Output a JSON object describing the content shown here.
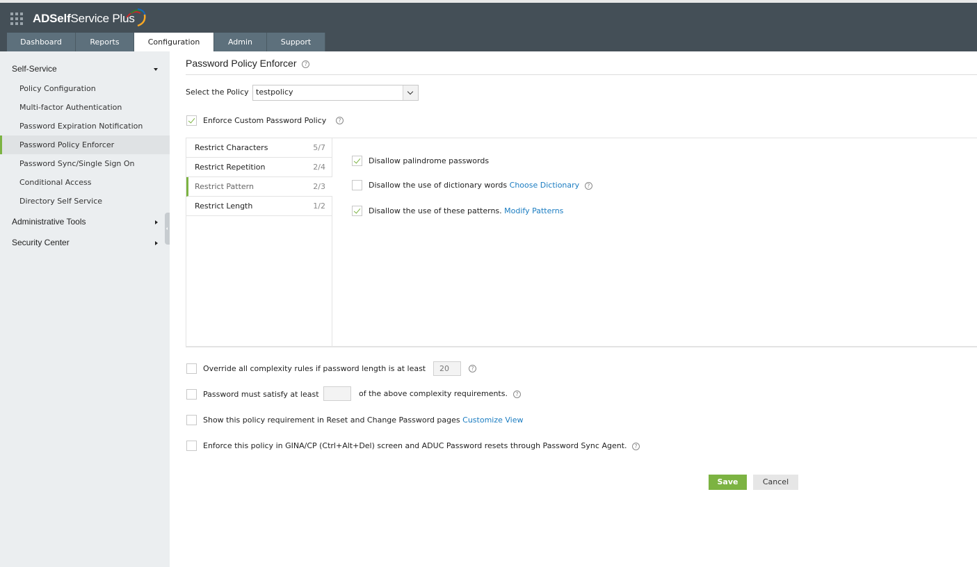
{
  "app": {
    "brand_bold": "ADSelf",
    "brand_rest": "Service Plus"
  },
  "tabs": [
    {
      "label": "Dashboard",
      "active": false
    },
    {
      "label": "Reports",
      "active": false
    },
    {
      "label": "Configuration",
      "active": true
    },
    {
      "label": "Admin",
      "active": false
    },
    {
      "label": "Support",
      "active": false
    }
  ],
  "sidebar": {
    "sections": [
      {
        "label": "Self-Service",
        "expanded": true
      },
      {
        "label": "Administrative Tools",
        "expanded": false
      },
      {
        "label": "Security Center",
        "expanded": false
      }
    ],
    "items": [
      {
        "label": "Policy Configuration"
      },
      {
        "label": "Multi-factor Authentication"
      },
      {
        "label": "Password Expiration Notification"
      },
      {
        "label": "Password Policy Enforcer",
        "active": true
      },
      {
        "label": "Password Sync/Single Sign On"
      },
      {
        "label": "Conditional Access"
      },
      {
        "label": "Directory Self Service"
      }
    ]
  },
  "main": {
    "title": "Password Policy Enforcer",
    "help_glyph": "?",
    "select_policy_label": "Select the Policy",
    "select_policy_value": "testpolicy",
    "enforce_custom": {
      "label": "Enforce Custom Password Policy",
      "checked": true
    },
    "restrict_tabs": [
      {
        "label": "Restrict Characters",
        "count": "5/7"
      },
      {
        "label": "Restrict Repetition",
        "count": "2/4"
      },
      {
        "label": "Restrict Pattern",
        "count": "2/3",
        "active": true
      },
      {
        "label": "Restrict Length",
        "count": "1/2"
      }
    ],
    "pattern_options": [
      {
        "label": "Disallow palindrome passwords",
        "checked": true
      },
      {
        "label": "Disallow the use of dictionary words",
        "link": "Choose Dictionary",
        "checked": false
      },
      {
        "label": "Disallow the use of these patterns.",
        "link": "Modify Patterns",
        "checked": true
      }
    ],
    "override": {
      "label": "Override all complexity rules if password length is at least",
      "value": "20",
      "checked": false
    },
    "satisfy": {
      "label_before": "Password must satisfy at least",
      "value": "",
      "label_after": "of the above complexity requirements.",
      "checked": false
    },
    "show_requirement": {
      "label": "Show this policy requirement in Reset and Change Password pages",
      "link": "Customize View",
      "checked": false
    },
    "enforce_gina": {
      "label": "Enforce this policy in GINA/CP (Ctrl+Alt+Del) screen and ADUC Password resets through Password Sync Agent.",
      "checked": false
    },
    "save_label": "Save",
    "cancel_label": "Cancel"
  }
}
